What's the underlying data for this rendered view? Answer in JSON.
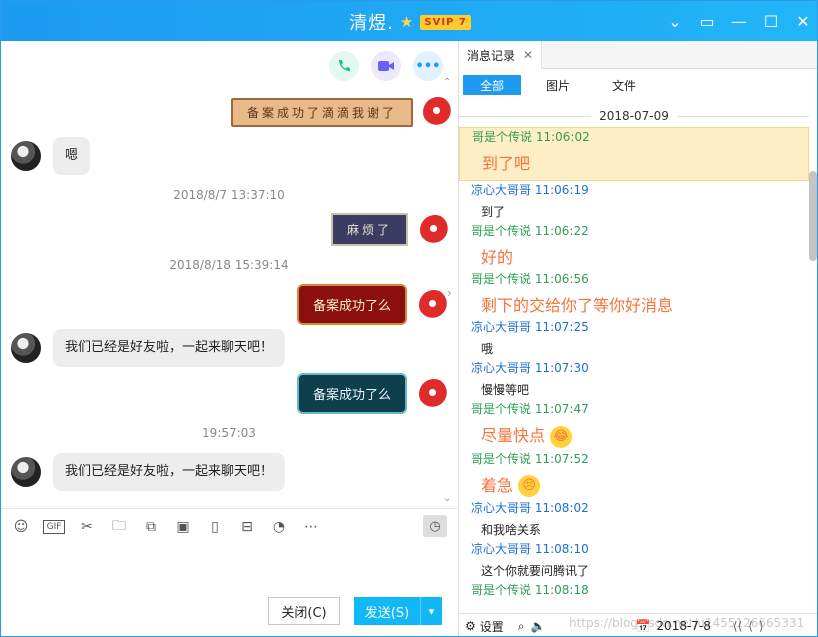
{
  "window": {
    "title": "清煜.",
    "badge": "SVIP 7",
    "buttons": [
      "chevron",
      "restore",
      "minimize",
      "maximize",
      "close"
    ]
  },
  "chat": {
    "top_actions": [
      "phone-call",
      "video-call",
      "more"
    ],
    "messages": [
      {
        "side": "right",
        "style": "paper",
        "text": "备案成功了滴滴我谢了"
      },
      {
        "side": "left",
        "text": "嗯"
      },
      {
        "type": "timestamp",
        "text": "2018/8/7 13:37:10"
      },
      {
        "side": "right",
        "style": "dark-scroll",
        "text": "麻烦了"
      },
      {
        "type": "timestamp",
        "text": "2018/8/18 15:39:14"
      },
      {
        "side": "right",
        "style": "red",
        "text": "备案成功了么"
      },
      {
        "side": "left",
        "text": "我们已经是好友啦，一起来聊天吧！"
      },
      {
        "side": "right",
        "style": "teal",
        "text": "备案成功了么"
      },
      {
        "type": "timestamp",
        "text": "19:57:03"
      },
      {
        "side": "left",
        "text": "我们已经是好友啦，一起来聊天吧！"
      }
    ],
    "toolbar_icons": [
      "emoji",
      "gif",
      "scissors",
      "folder",
      "screenshot",
      "image",
      "shake",
      "red-packet",
      "music",
      "more"
    ],
    "close_label": "关闭(C)",
    "send_label": "发送(S)"
  },
  "history": {
    "tab_label": "消息记录",
    "filters": [
      "全部",
      "图片",
      "文件"
    ],
    "active_filter": "全部",
    "date": "2018-07-09",
    "entries": [
      {
        "sender": "哥是个传说",
        "time": "11:06:02",
        "who": "me",
        "text": "到了吧",
        "style": "orange",
        "highlight": true
      },
      {
        "sender": "凉心大哥哥",
        "time": "11:06:19",
        "who": "other",
        "text": "到了",
        "style": "plain"
      },
      {
        "sender": "哥是个传说",
        "time": "11:06:22",
        "who": "me",
        "text": "好的",
        "style": "orange"
      },
      {
        "sender": "哥是个传说",
        "time": "11:06:56",
        "who": "me",
        "text": "剩下的交给你了等你好消息",
        "style": "orange"
      },
      {
        "sender": "凉心大哥哥",
        "time": "11:07:25",
        "who": "other",
        "text": "哦",
        "style": "plain"
      },
      {
        "sender": "凉心大哥哥",
        "time": "11:07:30",
        "who": "other",
        "text": "慢慢等吧",
        "style": "plain"
      },
      {
        "sender": "哥是个传说",
        "time": "11:07:47",
        "who": "me",
        "text": "尽量快点",
        "style": "orange",
        "emoji": "laugh"
      },
      {
        "sender": "哥是个传说",
        "time": "11:07:52",
        "who": "me",
        "text": "着急",
        "style": "orange",
        "emoji": "anxious"
      },
      {
        "sender": "凉心大哥哥",
        "time": "11:08:02",
        "who": "other",
        "text": "和我啥关系",
        "style": "plain"
      },
      {
        "sender": "凉心大哥哥",
        "time": "11:08:10",
        "who": "other",
        "text": "这个你就要问腾讯了",
        "style": "plain"
      },
      {
        "sender": "哥是个传说",
        "time": "11:08:18",
        "who": "me",
        "text": "",
        "style": "plain"
      }
    ],
    "bottom": {
      "settings_label": "设置",
      "date_value": "2018-7-8"
    },
    "watermark": "https://blog.csdn.net/u1455126665331"
  },
  "colors": {
    "titlebar": "#1c9bf0",
    "send_button": "#12b7f5",
    "me_name": "#2e9e57",
    "other_name": "#1f6fd1",
    "orange_text": "#f4743b"
  }
}
